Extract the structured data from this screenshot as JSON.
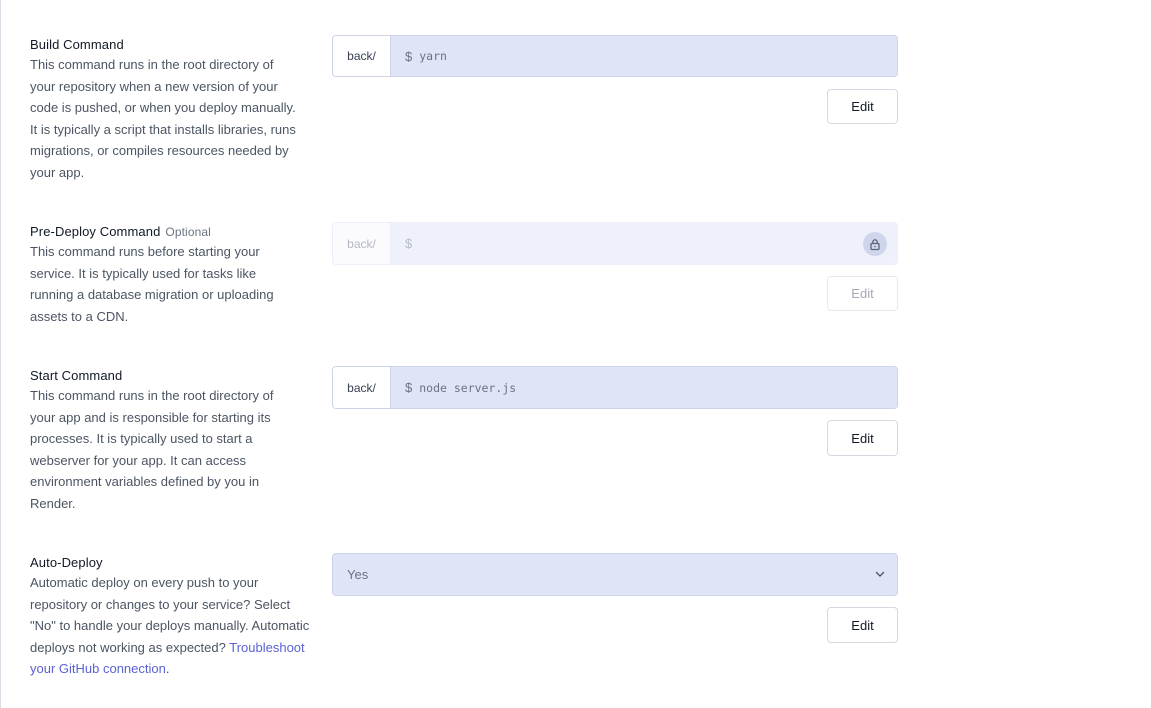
{
  "build": {
    "title": "Build Command",
    "description": "This command runs in the root directory of your repository when a new version of your code is pushed, or when you deploy manually. It is typically a script that installs libraries, runs migrations, or compiles resources needed by your app.",
    "prefix": "back/",
    "dollar": "$",
    "value": "yarn",
    "edit_label": "Edit"
  },
  "predeploy": {
    "title": "Pre-Deploy Command",
    "optional": "Optional",
    "description": "This command runs before starting your service. It is typically used for tasks like running a database migration or uploading assets to a CDN.",
    "prefix": "back/",
    "dollar": "$",
    "value": "",
    "edit_label": "Edit",
    "locked": true
  },
  "start": {
    "title": "Start Command",
    "description": "This command runs in the root directory of your app and is responsible for starting its processes. It is typically used to start a webserver for your app. It can access environment variables defined by you in Render.",
    "prefix": "back/",
    "dollar": "$",
    "value": "node server.js",
    "edit_label": "Edit"
  },
  "autodeploy": {
    "title": "Auto-Deploy",
    "description": "Automatic deploy on every push to your repository or changes to your service? Select \"No\" to handle your deploys manually. Automatic deploys not working as expected?",
    "link": "Troubleshoot your GitHub connection",
    "link_suffix": ".",
    "selected": "Yes",
    "edit_label": "Edit"
  },
  "icons": {
    "lock": "lock-icon",
    "chevron": "chevron-down-icon"
  },
  "colors": {
    "input_bg": "#dfe5f6",
    "link": "#5b62d6",
    "border": "#cdd4ea"
  }
}
